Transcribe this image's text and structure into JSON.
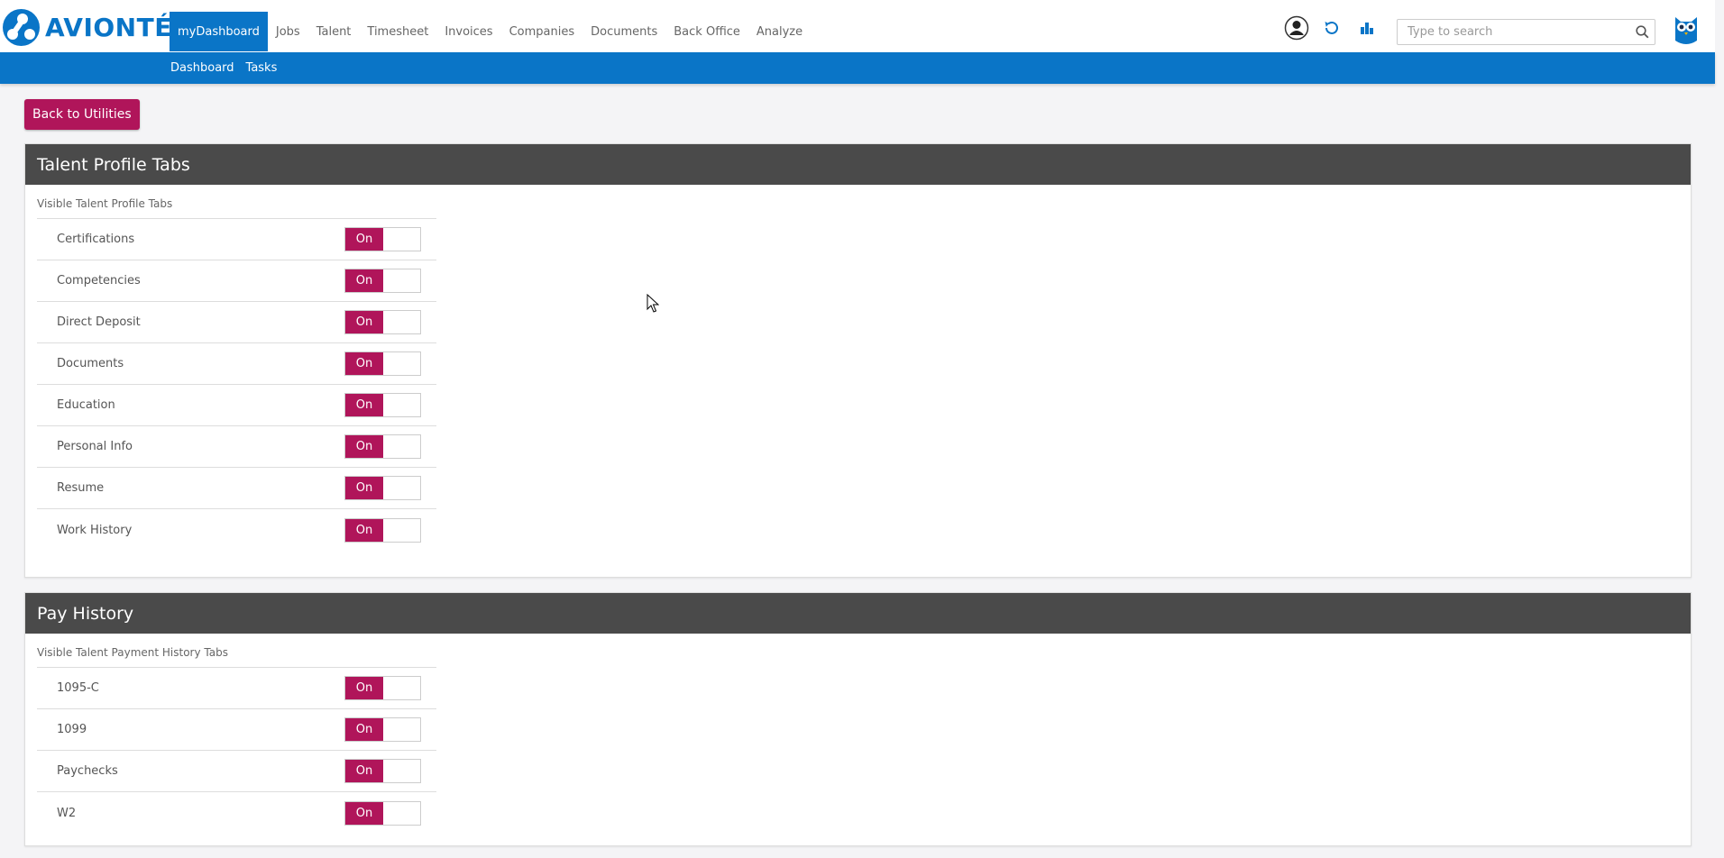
{
  "brand": {
    "name": "AVIONTÉ",
    "color": "#0a75c7"
  },
  "nav": {
    "items": [
      {
        "label": "myDashboard",
        "active": true
      },
      {
        "label": "Jobs"
      },
      {
        "label": "Talent"
      },
      {
        "label": "Timesheet"
      },
      {
        "label": "Invoices"
      },
      {
        "label": "Companies"
      },
      {
        "label": "Documents"
      },
      {
        "label": "Back Office"
      },
      {
        "label": "Analyze"
      }
    ]
  },
  "top_icons": [
    "user-icon",
    "refresh-icon",
    "chart-icon"
  ],
  "search": {
    "placeholder": "Type to search",
    "value": ""
  },
  "subnav": {
    "items": [
      {
        "label": "Dashboard"
      },
      {
        "label": "Tasks"
      }
    ]
  },
  "back_button": {
    "label": "Back to Utilities"
  },
  "colors": {
    "accent": "#b0155a",
    "header_bg": "#4a4a4a",
    "nav_bg": "#0a75c7"
  },
  "panels": [
    {
      "title": "Talent Profile Tabs",
      "subtitle": "Visible Talent Profile Tabs",
      "rows": [
        {
          "label": "Certifications",
          "state": "On"
        },
        {
          "label": "Competencies",
          "state": "On"
        },
        {
          "label": "Direct Deposit",
          "state": "On"
        },
        {
          "label": "Documents",
          "state": "On"
        },
        {
          "label": "Education",
          "state": "On"
        },
        {
          "label": "Personal Info",
          "state": "On"
        },
        {
          "label": "Resume",
          "state": "On"
        },
        {
          "label": "Work History",
          "state": "On"
        }
      ]
    },
    {
      "title": "Pay History",
      "subtitle": "Visible Talent Payment History Tabs",
      "rows": [
        {
          "label": "1095-C",
          "state": "On"
        },
        {
          "label": "1099",
          "state": "On"
        },
        {
          "label": "Paychecks",
          "state": "On"
        },
        {
          "label": "W2",
          "state": "On"
        }
      ]
    }
  ]
}
